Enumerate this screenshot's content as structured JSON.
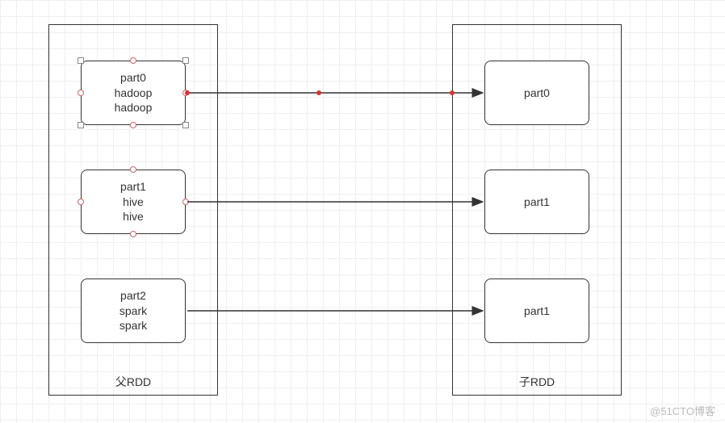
{
  "parent": {
    "label": "父RDD",
    "parts": [
      {
        "name": "part0",
        "lines": [
          "part0",
          "hadoop",
          "hadoop"
        ],
        "selected": true
      },
      {
        "name": "part1",
        "lines": [
          "part1",
          "hive",
          "hive"
        ],
        "selected": false
      },
      {
        "name": "part2",
        "lines": [
          "part2",
          "spark",
          "spark"
        ],
        "selected": false
      }
    ]
  },
  "child": {
    "label": "子RDD",
    "parts": [
      {
        "name": "part0",
        "lines": [
          "part0"
        ]
      },
      {
        "name": "part1",
        "lines": [
          "part1"
        ]
      },
      {
        "name": "part2",
        "lines": [
          "part1"
        ]
      }
    ]
  },
  "arrows": [
    {
      "from": "parent.part0",
      "to": "child.part0",
      "highlighted": true
    },
    {
      "from": "parent.part1",
      "to": "child.part1",
      "highlighted": false
    },
    {
      "from": "parent.part2",
      "to": "child.part2",
      "highlighted": false
    }
  ],
  "watermark": "@51CTO博客",
  "chart_data": {
    "type": "diagram",
    "title": "RDD narrow dependency (one parent partition -> one child partition)",
    "nodes": [
      {
        "id": "parentRDD",
        "label": "父RDD",
        "children": [
          "p0",
          "p1",
          "p2"
        ]
      },
      {
        "id": "p0",
        "label": "part0",
        "content": [
          "hadoop",
          "hadoop"
        ]
      },
      {
        "id": "p1",
        "label": "part1",
        "content": [
          "hive",
          "hive"
        ]
      },
      {
        "id": "p2",
        "label": "part2",
        "content": [
          "spark",
          "spark"
        ]
      },
      {
        "id": "childRDD",
        "label": "子RDD",
        "children": [
          "c0",
          "c1",
          "c2"
        ]
      },
      {
        "id": "c0",
        "label": "part0"
      },
      {
        "id": "c1",
        "label": "part1"
      },
      {
        "id": "c2",
        "label": "part1"
      }
    ],
    "edges": [
      {
        "from": "p0",
        "to": "c0"
      },
      {
        "from": "p1",
        "to": "c1"
      },
      {
        "from": "p2",
        "to": "c2"
      }
    ]
  }
}
